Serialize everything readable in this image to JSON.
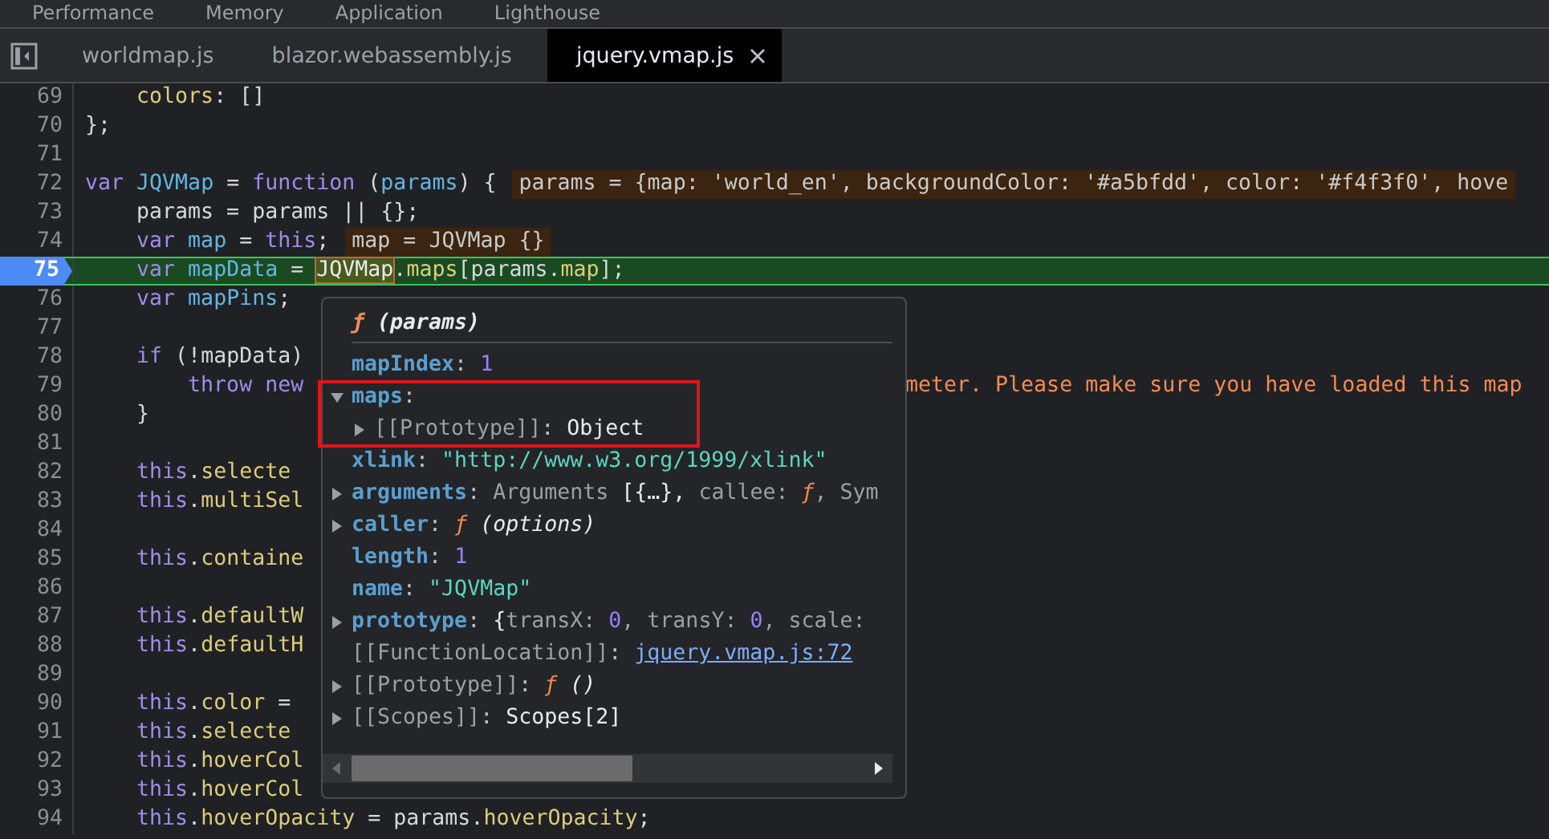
{
  "panel_tabs": [
    "Performance",
    "Memory",
    "Application",
    "Lighthouse"
  ],
  "file_tabs": [
    {
      "label": "worldmap.js",
      "selected": false
    },
    {
      "label": "blazor.webassembly.js",
      "selected": false
    },
    {
      "label": "jquery.vmap.js",
      "selected": true
    }
  ],
  "code_lines": [
    {
      "number": "69",
      "current": false,
      "tokens": [
        {
          "text": "    colors",
          "kind": "prop"
        },
        {
          "text": ": []",
          "kind": "plain"
        }
      ]
    },
    {
      "number": "70",
      "current": false,
      "tokens": [
        {
          "text": "};",
          "kind": "plain"
        }
      ]
    },
    {
      "number": "71",
      "current": false
    },
    {
      "number": "72",
      "current": false,
      "tokens": [
        {
          "text": "var",
          "kind": "kw"
        },
        {
          "text": " JQVMap",
          "kind": "def"
        },
        {
          "text": " = ",
          "kind": "plain"
        },
        {
          "text": "function",
          "kind": "kw"
        },
        {
          "text": " (",
          "kind": "plain"
        },
        {
          "text": "params",
          "kind": "def"
        },
        {
          "text": ") {",
          "kind": "plain"
        }
      ],
      "inline_value": "params = {map: 'world_en', backgroundColor: '#a5bfdd', color: '#f4f3f0', hove"
    },
    {
      "number": "73",
      "current": false,
      "tokens": [
        {
          "text": "    params = params || {};",
          "kind": "plain"
        }
      ]
    },
    {
      "number": "74",
      "current": false,
      "tokens": [
        {
          "text": "    var",
          "kind": "kw"
        },
        {
          "text": " map",
          "kind": "def"
        },
        {
          "text": " = ",
          "kind": "plain"
        },
        {
          "text": "this",
          "kind": "kw"
        },
        {
          "text": ";",
          "kind": "plain"
        }
      ],
      "inline_value": "map = JQVMap {}"
    },
    {
      "number": "75",
      "current": true,
      "tokens": [
        {
          "text": "    var",
          "kind": "kw"
        },
        {
          "text": " mapData",
          "kind": "def"
        },
        {
          "text": " = ",
          "kind": "plain"
        },
        {
          "text": "JQVMap",
          "kind": "hover"
        },
        {
          "text": ".",
          "kind": "plain"
        },
        {
          "text": "maps",
          "kind": "prop"
        },
        {
          "text": "[params.",
          "kind": "plain"
        },
        {
          "text": "map",
          "kind": "prop"
        },
        {
          "text": "];",
          "kind": "plain"
        }
      ]
    },
    {
      "number": "76",
      "current": false,
      "tokens": [
        {
          "text": "    var",
          "kind": "kw"
        },
        {
          "text": " mapPins",
          "kind": "def"
        },
        {
          "text": ";",
          "kind": "plain"
        }
      ]
    },
    {
      "number": "77",
      "current": false
    },
    {
      "number": "78",
      "current": false,
      "tokens": [
        {
          "text": "    if",
          "kind": "kw"
        },
        {
          "text": " (!mapData)",
          "kind": "plain"
        }
      ]
    },
    {
      "number": "79",
      "current": false,
      "tokens": [
        {
          "text": "        throw new",
          "kind": "kw"
        }
      ],
      "tail": "meter. Please make sure you have loaded this map"
    },
    {
      "number": "80",
      "current": false,
      "tokens": [
        {
          "text": "    }",
          "kind": "plain"
        }
      ]
    },
    {
      "number": "81",
      "current": false
    },
    {
      "number": "82",
      "current": false,
      "tokens": [
        {
          "text": "    this",
          "kind": "kw"
        },
        {
          "text": ".",
          "kind": "plain"
        },
        {
          "text": "selecte",
          "kind": "prop"
        }
      ]
    },
    {
      "number": "83",
      "current": false,
      "tokens": [
        {
          "text": "    this",
          "kind": "kw"
        },
        {
          "text": ".",
          "kind": "plain"
        },
        {
          "text": "multiSel",
          "kind": "prop"
        }
      ]
    },
    {
      "number": "84",
      "current": false
    },
    {
      "number": "85",
      "current": false,
      "tokens": [
        {
          "text": "    this",
          "kind": "kw"
        },
        {
          "text": ".",
          "kind": "plain"
        },
        {
          "text": "containe",
          "kind": "prop"
        }
      ]
    },
    {
      "number": "86",
      "current": false
    },
    {
      "number": "87",
      "current": false,
      "tokens": [
        {
          "text": "    this",
          "kind": "kw"
        },
        {
          "text": ".",
          "kind": "plain"
        },
        {
          "text": "defaultW",
          "kind": "prop"
        }
      ]
    },
    {
      "number": "88",
      "current": false,
      "tokens": [
        {
          "text": "    this",
          "kind": "kw"
        },
        {
          "text": ".",
          "kind": "plain"
        },
        {
          "text": "defaultH",
          "kind": "prop"
        }
      ]
    },
    {
      "number": "89",
      "current": false
    },
    {
      "number": "90",
      "current": false,
      "tokens": [
        {
          "text": "    this",
          "kind": "kw"
        },
        {
          "text": ".",
          "kind": "plain"
        },
        {
          "text": "color",
          "kind": "prop"
        },
        {
          "text": " =",
          "kind": "plain"
        }
      ]
    },
    {
      "number": "91",
      "current": false,
      "tokens": [
        {
          "text": "    this",
          "kind": "kw"
        },
        {
          "text": ".",
          "kind": "plain"
        },
        {
          "text": "selecte",
          "kind": "prop"
        }
      ]
    },
    {
      "number": "92",
      "current": false,
      "tokens": [
        {
          "text": "    this",
          "kind": "kw"
        },
        {
          "text": ".",
          "kind": "plain"
        },
        {
          "text": "hoverCol",
          "kind": "prop"
        }
      ]
    },
    {
      "number": "93",
      "current": false,
      "tokens": [
        {
          "text": "    this",
          "kind": "kw"
        },
        {
          "text": ".",
          "kind": "plain"
        },
        {
          "text": "hoverCol",
          "kind": "prop"
        }
      ]
    },
    {
      "number": "94",
      "current": false,
      "tokens": [
        {
          "text": "    this",
          "kind": "kw"
        },
        {
          "text": ".",
          "kind": "plain"
        },
        {
          "text": "hoverOpacity",
          "kind": "prop"
        },
        {
          "text": " = params.",
          "kind": "plain"
        },
        {
          "text": "hoverOpacity",
          "kind": "prop"
        },
        {
          "text": ";",
          "kind": "plain"
        }
      ]
    }
  ],
  "popover": {
    "title": [
      {
        "text": "ƒ",
        "kind": "fn"
      },
      {
        "text": " (params)",
        "kind": "title"
      }
    ],
    "rows": [
      {
        "kind": "leaf",
        "key": "mapIndex",
        "internal": false,
        "separator": ": ",
        "value": [
          {
            "text": "1",
            "kind": "num"
          }
        ]
      },
      {
        "kind": "node",
        "expanded": true,
        "key": "maps",
        "internal": false,
        "separator": ":",
        "highlighted": true,
        "children": [
          {
            "kind": "node",
            "expanded": false,
            "key": "[[Prototype]]",
            "internal": true,
            "separator": ": ",
            "value": [
              {
                "text": "Object",
                "kind": "obj"
              }
            ]
          }
        ]
      },
      {
        "kind": "leaf",
        "key": "xlink",
        "internal": false,
        "separator": ": ",
        "value": [
          {
            "text": "\"http://www.w3.org/1999/xlink\"",
            "kind": "str"
          }
        ]
      },
      {
        "kind": "node",
        "expanded": false,
        "key": "arguments",
        "internal": false,
        "separator": ": ",
        "value": [
          {
            "text": "Arguments ",
            "kind": "plain"
          },
          {
            "text": "[{…}, ",
            "kind": "obj"
          },
          {
            "text": "callee: ",
            "kind": "plain"
          },
          {
            "text": "ƒ",
            "kind": "fn"
          },
          {
            "text": ", Sym",
            "kind": "plain"
          }
        ]
      },
      {
        "kind": "node",
        "expanded": false,
        "key": "caller",
        "internal": false,
        "separator": ": ",
        "value": [
          {
            "text": "ƒ",
            "kind": "fn"
          },
          {
            "text": " (options)",
            "kind": "italic"
          }
        ]
      },
      {
        "kind": "leaf",
        "key": "length",
        "internal": false,
        "separator": ": ",
        "value": [
          {
            "text": "1",
            "kind": "num"
          }
        ]
      },
      {
        "kind": "leaf",
        "key": "name",
        "internal": false,
        "separator": ": ",
        "value": [
          {
            "text": "\"JQVMap\"",
            "kind": "str"
          }
        ]
      },
      {
        "kind": "node",
        "expanded": false,
        "key": "prototype",
        "internal": false,
        "separator": ": ",
        "value": [
          {
            "text": "{",
            "kind": "obj"
          },
          {
            "text": "transX: ",
            "kind": "plain"
          },
          {
            "text": "0",
            "kind": "num"
          },
          {
            "text": ", transY: ",
            "kind": "plain"
          },
          {
            "text": "0",
            "kind": "num"
          },
          {
            "text": ", scale:",
            "kind": "plain"
          }
        ]
      },
      {
        "kind": "leaf",
        "key": "[[FunctionLocation]]",
        "internal": true,
        "separator": ": ",
        "value": [
          {
            "text": "jquery.vmap.js:72",
            "kind": "link"
          }
        ]
      },
      {
        "kind": "node",
        "expanded": false,
        "key": "[[Prototype]]",
        "internal": true,
        "separator": ": ",
        "value": [
          {
            "text": "ƒ",
            "kind": "fn"
          },
          {
            "text": " ()",
            "kind": "italic"
          }
        ]
      },
      {
        "kind": "node",
        "expanded": false,
        "key": "[[Scopes]]",
        "internal": true,
        "separator": ": ",
        "value": [
          {
            "text": "Scopes[2]",
            "kind": "obj"
          }
        ]
      }
    ]
  }
}
